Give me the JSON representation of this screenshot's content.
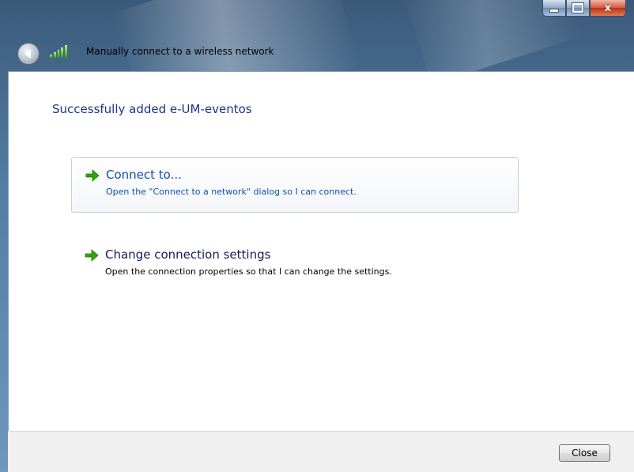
{
  "window": {
    "title": "Manually connect to a wireless network",
    "caption_buttons": {
      "minimize_icon": "minimize-icon",
      "maximize_icon": "maximize-icon",
      "close_glyph": "x"
    },
    "back_icon": "back-arrow-icon",
    "network_icon": "wireless-signal-icon"
  },
  "main": {
    "heading": "Successfully added e-UM-eventos",
    "options": [
      {
        "title": "Connect to...",
        "description": "Open the \"Connect to a network\" dialog so I can connect.",
        "icon": "green-arrow-icon"
      },
      {
        "title": "Change connection settings",
        "description": "Open the connection properties so that I can change the settings.",
        "icon": "green-arrow-icon"
      }
    ]
  },
  "footer": {
    "close_label": "Close"
  },
  "colors": {
    "heading": "#1e3287",
    "link": "#0f4fae",
    "arrow": "#2fa60a",
    "glass": "#527ea5"
  }
}
